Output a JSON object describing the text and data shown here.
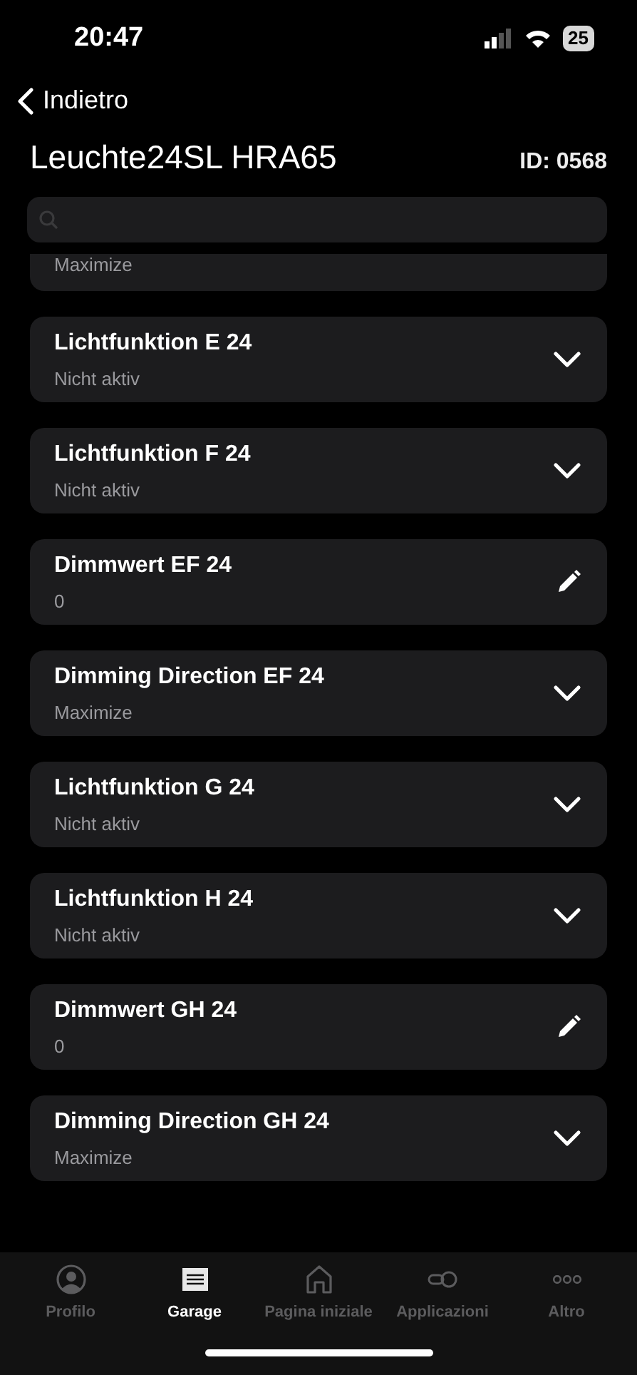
{
  "status_bar": {
    "time": "20:47",
    "battery": "25"
  },
  "nav": {
    "back": "Indietro"
  },
  "header": {
    "title": "Leuchte24SL HRA65",
    "id": "ID: 0568"
  },
  "partial_item": {
    "value": "Maximize"
  },
  "items": [
    {
      "title": "Lichtfunktion E 24",
      "value": "Nicht aktiv",
      "kind": "dropdown"
    },
    {
      "title": "Lichtfunktion F 24",
      "value": "Nicht aktiv",
      "kind": "dropdown"
    },
    {
      "title": "Dimmwert EF 24",
      "value": "0",
      "kind": "edit"
    },
    {
      "title": "Dimming Direction EF 24",
      "value": "Maximize",
      "kind": "dropdown"
    },
    {
      "title": "Lichtfunktion G 24",
      "value": "Nicht aktiv",
      "kind": "dropdown"
    },
    {
      "title": "Lichtfunktion H 24",
      "value": "Nicht aktiv",
      "kind": "dropdown"
    },
    {
      "title": "Dimmwert GH 24",
      "value": "0",
      "kind": "edit"
    },
    {
      "title": "Dimming Direction GH 24",
      "value": "Maximize",
      "kind": "dropdown"
    }
  ],
  "tab_bar": [
    {
      "label": "Profilo",
      "kind": "profile",
      "selected": false
    },
    {
      "label": "Garage",
      "kind": "garage",
      "selected": true
    },
    {
      "label": "Pagina iniziale",
      "kind": "home",
      "selected": false
    },
    {
      "label": "Applicazioni",
      "kind": "apps",
      "selected": false
    },
    {
      "label": "Altro",
      "kind": "more",
      "selected": false
    }
  ]
}
